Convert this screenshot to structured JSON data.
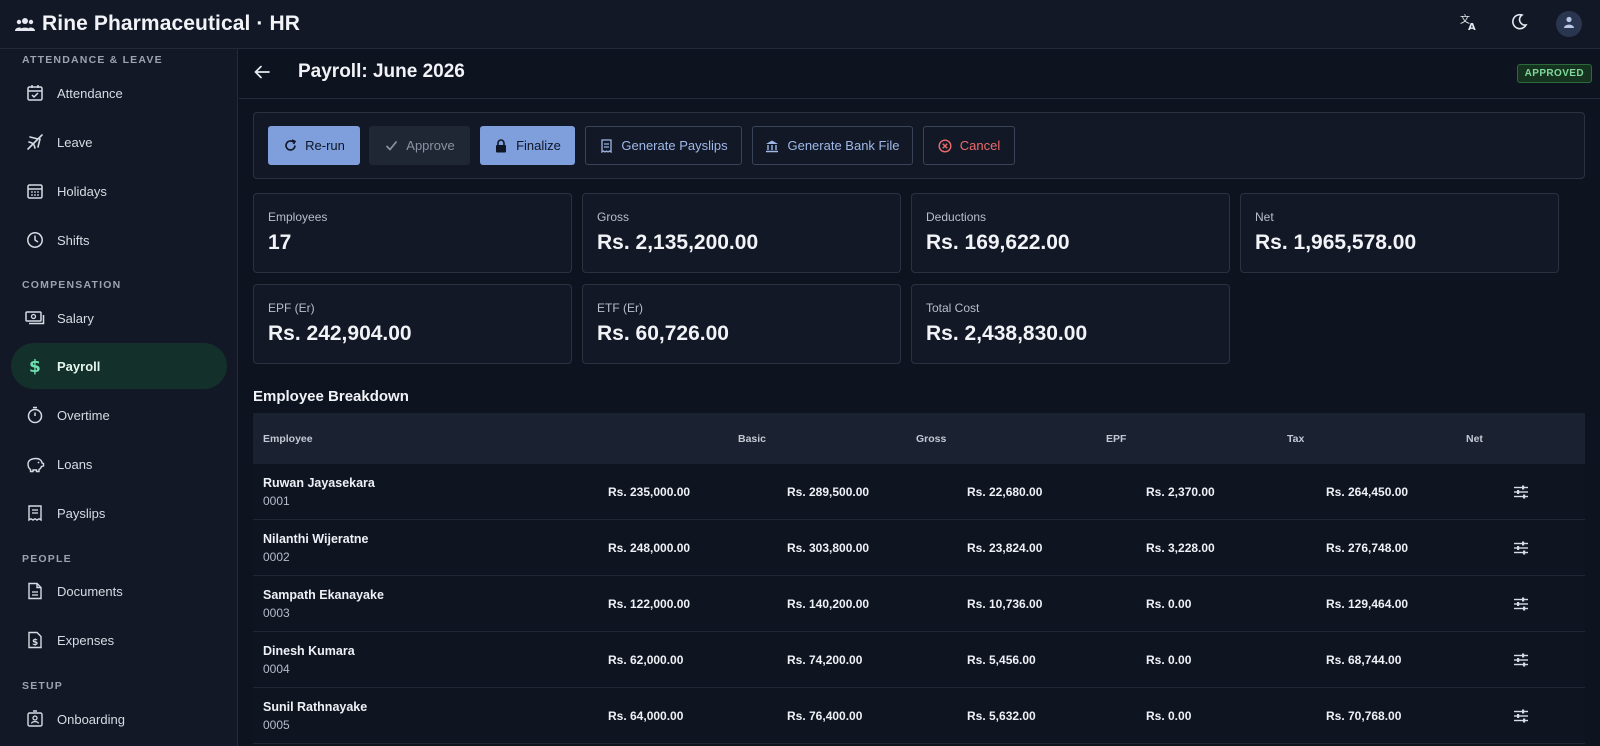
{
  "app": {
    "title": "Rine Pharmaceutical · HR",
    "brand_icon": "people-group-icon"
  },
  "topbar": {
    "translate_icon": "translate-icon",
    "theme_icon": "moon-icon",
    "account_icon": "user-icon"
  },
  "sidebar": {
    "sections": [
      {
        "label": "ATTENDANCE & LEAVE"
      },
      {
        "label": "COMPENSATION"
      },
      {
        "label": "PEOPLE"
      },
      {
        "label": "SETUP"
      }
    ],
    "items": [
      {
        "label": "Attendance",
        "icon": "calendar-check-icon"
      },
      {
        "label": "Leave",
        "icon": "plane-icon"
      },
      {
        "label": "Holidays",
        "icon": "calendar-grid-icon"
      },
      {
        "label": "Shifts",
        "icon": "clock-icon"
      },
      {
        "label": "Salary",
        "icon": "money-icon"
      },
      {
        "label": "Payroll",
        "icon": "dollar-icon",
        "active": true
      },
      {
        "label": "Overtime",
        "icon": "stopwatch-icon"
      },
      {
        "label": "Loans",
        "icon": "piggy-bank-icon"
      },
      {
        "label": "Payslips",
        "icon": "receipt-icon"
      },
      {
        "label": "Documents",
        "icon": "document-icon"
      },
      {
        "label": "Expenses",
        "icon": "expense-icon"
      },
      {
        "label": "Onboarding",
        "icon": "badge-icon"
      }
    ]
  },
  "page": {
    "title": "Payroll: June 2026",
    "status": "APPROVED",
    "status_color": "#7fd99b"
  },
  "toolbar": {
    "rerun": "Re-run",
    "approve": "Approve",
    "finalize": "Finalize",
    "generate_payslips": "Generate Payslips",
    "generate_bank_file": "Generate Bank File",
    "cancel": "Cancel"
  },
  "summary": [
    {
      "label": "Employees",
      "value": "17"
    },
    {
      "label": "Gross",
      "value": "Rs. 2,135,200.00"
    },
    {
      "label": "Deductions",
      "value": "Rs. 169,622.00"
    },
    {
      "label": "Net",
      "value": "Rs. 1,965,578.00"
    },
    {
      "label": "EPF (Er)",
      "value": "Rs. 242,904.00"
    },
    {
      "label": "ETF (Er)",
      "value": "Rs. 60,726.00"
    },
    {
      "label": "Total Cost",
      "value": "Rs. 2,438,830.00"
    }
  ],
  "breakdown": {
    "title": "Employee Breakdown",
    "columns": [
      "Employee",
      "Basic",
      "Gross",
      "EPF",
      "Tax",
      "Net"
    ],
    "rows": [
      {
        "name": "Ruwan Jayasekara",
        "code": "0001",
        "basic": "Rs. 235,000.00",
        "gross": "Rs. 289,500.00",
        "epf": "Rs. 22,680.00",
        "tax": "Rs. 2,370.00",
        "net": "Rs. 264,450.00"
      },
      {
        "name": "Nilanthi Wijeratne",
        "code": "0002",
        "basic": "Rs. 248,000.00",
        "gross": "Rs. 303,800.00",
        "epf": "Rs. 23,824.00",
        "tax": "Rs. 3,228.00",
        "net": "Rs. 276,748.00"
      },
      {
        "name": "Sampath Ekanayake",
        "code": "0003",
        "basic": "Rs. 122,000.00",
        "gross": "Rs. 140,200.00",
        "epf": "Rs. 10,736.00",
        "tax": "Rs. 0.00",
        "net": "Rs. 129,464.00"
      },
      {
        "name": "Dinesh Kumara",
        "code": "0004",
        "basic": "Rs. 62,000.00",
        "gross": "Rs. 74,200.00",
        "epf": "Rs. 5,456.00",
        "tax": "Rs. 0.00",
        "net": "Rs. 68,744.00"
      },
      {
        "name": "Sunil Rathnayake",
        "code": "0005",
        "basic": "Rs. 64,000.00",
        "gross": "Rs. 76,400.00",
        "epf": "Rs. 5,632.00",
        "tax": "Rs. 0.00",
        "net": "Rs. 70,768.00"
      }
    ]
  }
}
